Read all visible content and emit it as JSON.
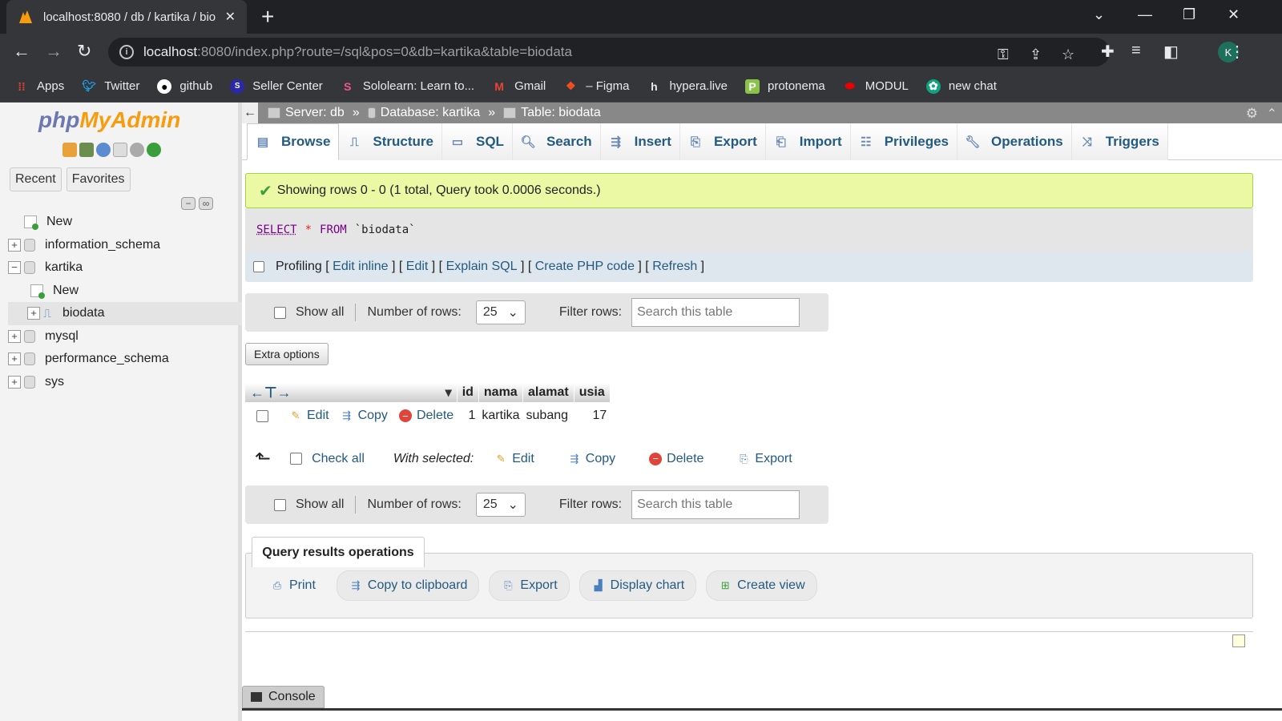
{
  "browser": {
    "tab_title": "localhost:8080 / db / kartika / bio",
    "url_host": "localhost",
    "url_path": ":8080/index.php?route=/sql&pos=0&db=kartika&table=biodata",
    "profile_initial": "K",
    "bookmarks": [
      "Apps",
      "Twitter",
      "github",
      "Seller Center",
      "Sololearn: Learn to...",
      "Gmail",
      "– Figma",
      "hypera.live",
      "protonema",
      "MODUL",
      "new chat"
    ]
  },
  "nav": {
    "logo_php": "php",
    "logo_myadmin": "MyAdmin",
    "tabs": [
      "Recent",
      "Favorites"
    ],
    "tree": [
      {
        "label": "New"
      },
      {
        "label": "information_schema"
      },
      {
        "label": "kartika"
      },
      {
        "label": "New"
      },
      {
        "label": "biodata"
      },
      {
        "label": "mysql"
      },
      {
        "label": "performance_schema"
      },
      {
        "label": "sys"
      }
    ]
  },
  "breadcrumb": {
    "server": "Server: db",
    "database": "Database: kartika",
    "table": "Table: biodata",
    "sep": "»"
  },
  "menu": [
    "Browse",
    "Structure",
    "SQL",
    "Search",
    "Insert",
    "Export",
    "Import",
    "Privileges",
    "Operations",
    "Triggers"
  ],
  "result": {
    "message": "Showing rows 0 - 0 (1 total, Query took 0.0006 seconds.)",
    "sql_select": "SELECT",
    "sql_star": "*",
    "sql_from": "FROM",
    "sql_table": "`biodata`",
    "profiling": "Profiling",
    "links": [
      "Edit inline",
      "Edit",
      "Explain SQL",
      "Create PHP code",
      "Refresh"
    ]
  },
  "navbar": {
    "show_all": "Show all",
    "num_rows_label": "Number of rows:",
    "num_rows_value": "25",
    "filter_label": "Filter rows:",
    "filter_placeholder": "Search this table"
  },
  "extra_options": "Extra options",
  "table": {
    "columns": [
      "id",
      "nama",
      "alamat",
      "usia"
    ],
    "row_actions": [
      "Edit",
      "Copy",
      "Delete"
    ],
    "rows": [
      [
        "1",
        "kartika",
        "subang",
        "17"
      ]
    ]
  },
  "with_selected": {
    "check_all": "Check all",
    "label": "With selected:",
    "actions": [
      "Edit",
      "Copy",
      "Delete",
      "Export"
    ]
  },
  "query_ops": {
    "title": "Query results operations",
    "buttons": [
      "Print",
      "Copy to clipboard",
      "Export",
      "Display chart",
      "Create view"
    ]
  },
  "console": "Console"
}
